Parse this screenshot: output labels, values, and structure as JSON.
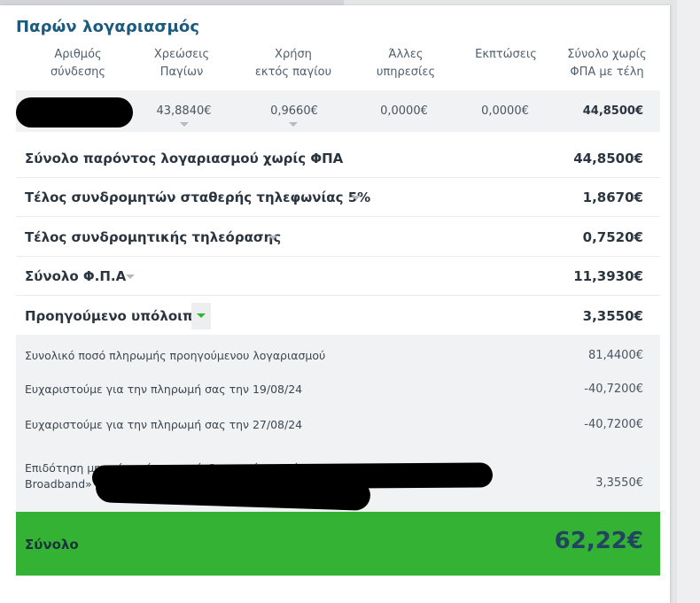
{
  "title": "Παρών λογαριασμός",
  "columns": [
    {
      "line1": "Αριθμός",
      "line2": "σύνδεσης"
    },
    {
      "line1": "Χρεώσεις",
      "line2": "Παγίων"
    },
    {
      "line1": "Χρήση",
      "line2": "εκτός παγίου"
    },
    {
      "line1": "Άλλες",
      "line2": "υπηρεσίες"
    },
    {
      "line1": "Εκπτώσεις",
      "line2": ""
    },
    {
      "line1": "Σύνολο χωρίς",
      "line2": "ΦΠΑ με τέλη"
    }
  ],
  "connection_row": {
    "fixed_charges": "43,8840€",
    "extra_usage": "0,9660€",
    "other_services": "0,0000€",
    "discounts": "0,0000€",
    "total_no_vat": "44,8500€"
  },
  "summary": [
    {
      "label": "Σύνολο παρόντος λογαριασμού χωρίς ΦΠΑ",
      "value": "44,8500€"
    },
    {
      "label": "Τέλος συνδρομητών σταθερής τηλεφωνίας 5%",
      "value": "1,8670€"
    },
    {
      "label": "Τέλος συνδρομητικής τηλεόρασης",
      "value": "0,7520€"
    },
    {
      "label": "Σύνολο Φ.Π.Α",
      "value": "11,3930€"
    },
    {
      "label": "Προηγούμενο υπόλοιπο",
      "value": "3,3550€"
    }
  ],
  "previous_balance_details": [
    {
      "label": "Συνολικό ποσό πληρωμής προηγούμενου λογαριασμού",
      "value": "81,4400€"
    },
    {
      "label": "Ευχαριστούμε για την πληρωμή σας την 19/08/24",
      "value": "-40,7200€"
    },
    {
      "label": "Ευχαριστούμε για την πληρωμή σας την 27/08/24",
      "value": "-40,7200€"
    },
    {
      "label_line1": "Επιδότηση μηνιαίου κόστους σύνδεσης μέσω δράσης «Superfast",
      "label_line2": "Broadband»",
      "value": "3,3550€"
    }
  ],
  "total": {
    "label": "Σύνολο",
    "value": "62,22€"
  },
  "colors": {
    "accent_green": "#33b233",
    "title_blue": "#1c5b7e",
    "dropdown_open": "#31b431"
  }
}
